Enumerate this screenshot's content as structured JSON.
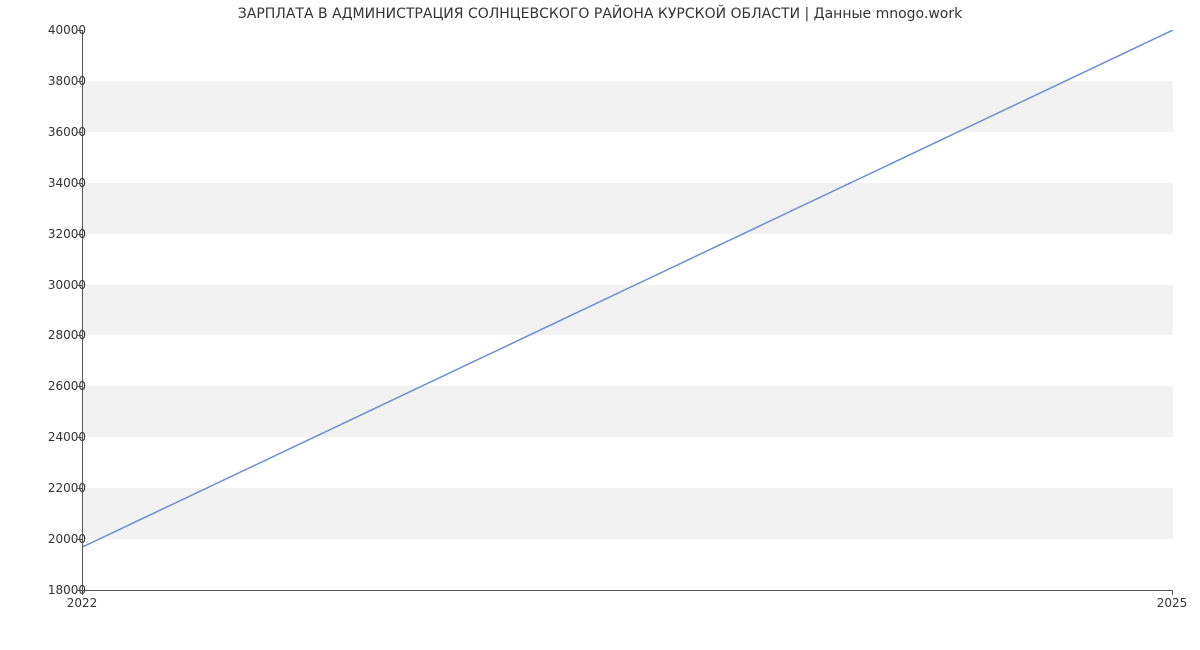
{
  "chart_data": {
    "type": "line",
    "title": "ЗАРПЛАТА В АДМИНИСТРАЦИЯ СОЛНЦЕВСКОГО РАЙОНА КУРСКОЙ ОБЛАСТИ | Данные mnogo.work",
    "x": [
      2022,
      2025
    ],
    "values": [
      19700,
      40000
    ],
    "xlabel": "",
    "ylabel": "",
    "xlim": [
      2022,
      2025
    ],
    "ylim": [
      18000,
      40000
    ],
    "yticks": [
      18000,
      20000,
      22000,
      24000,
      26000,
      28000,
      30000,
      32000,
      34000,
      36000,
      38000,
      40000
    ],
    "xticks": [
      2022,
      2025
    ],
    "line_color": "#6b8fd4"
  }
}
